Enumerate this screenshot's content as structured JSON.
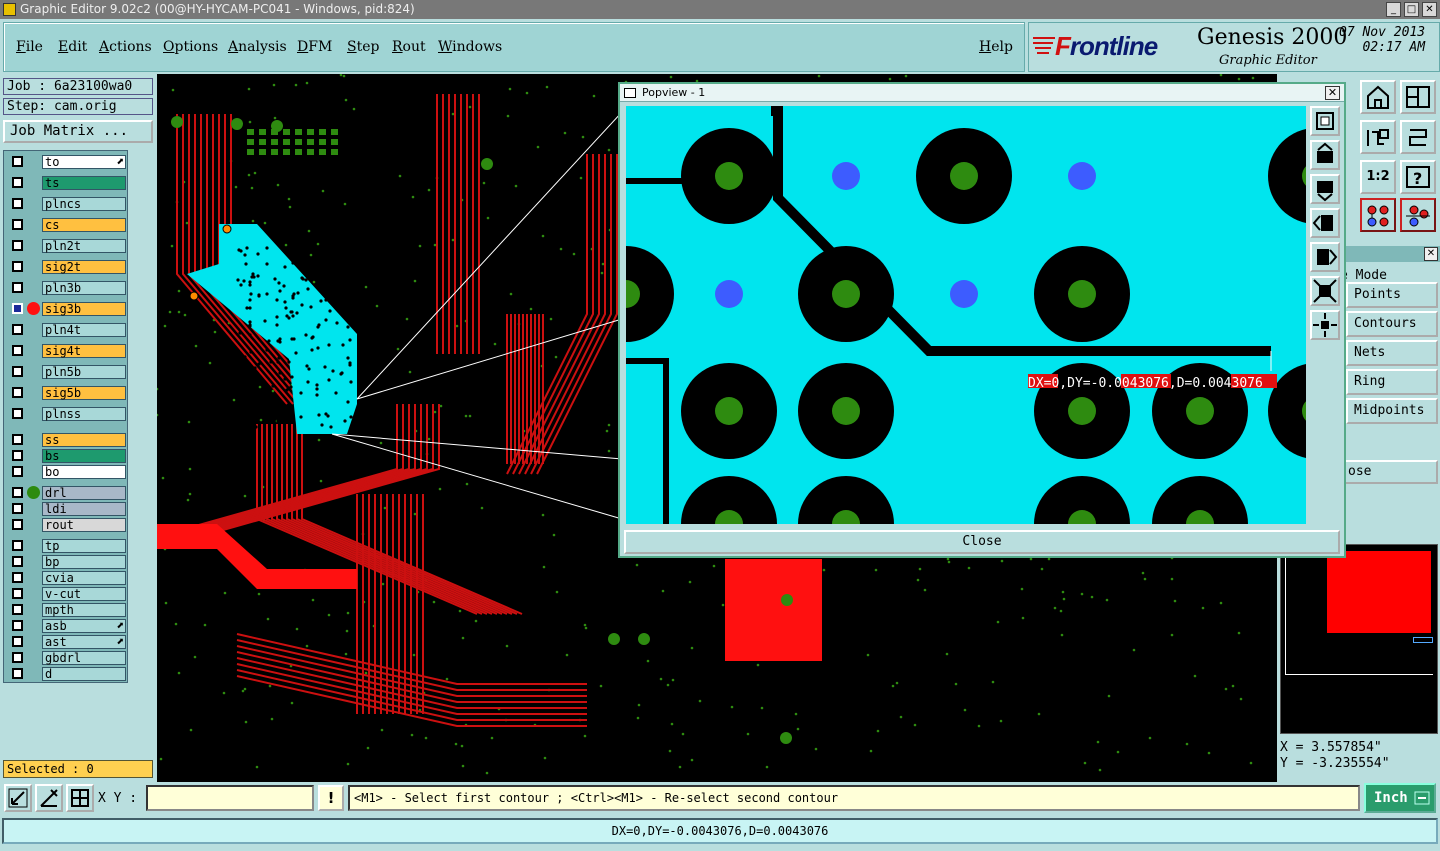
{
  "window": {
    "title": "Graphic Editor 9.02c2 (00@HY-HYCAM-PC041 - Windows, pid:824)"
  },
  "menu": [
    "File",
    "Edit",
    "Actions",
    "Options",
    "Analysis",
    "DFM",
    "Step",
    "Rout",
    "Windows"
  ],
  "help_label": "Help",
  "brand": {
    "logo_prefix": "F",
    "logo_rest": "rontline",
    "product": "Genesis 2000",
    "subtitle": "Graphic Editor",
    "date": "07 Nov 2013",
    "time": "02:17 AM"
  },
  "job": {
    "job": "Job : 6a23100wa0",
    "step": "Step: cam.orig",
    "matrix_button": "Job Matrix ..."
  },
  "layers": [
    {
      "name": "to",
      "color": "#ffffff"
    },
    {
      "name": "ts",
      "color": "#1e9a6e"
    },
    {
      "name": "plncs",
      "color": "#a8d8d8"
    },
    {
      "name": "cs",
      "color": "#ffc040"
    },
    {
      "name": "pln2t",
      "color": "#a8d8d8"
    },
    {
      "name": "sig2t",
      "color": "#ffc040"
    },
    {
      "name": "pln3b",
      "color": "#a8d8d8"
    },
    {
      "name": "sig3b",
      "color": "#ffc040"
    },
    {
      "name": "pln4t",
      "color": "#a8d8d8"
    },
    {
      "name": "sig4t",
      "color": "#ffc040"
    },
    {
      "name": "pln5b",
      "color": "#a8d8d8"
    },
    {
      "name": "sig5b",
      "color": "#ffc040"
    },
    {
      "name": "plnss",
      "color": "#a8d8d8"
    },
    {
      "name": "ss",
      "color": "#ffc040"
    },
    {
      "name": "bs",
      "color": "#1e9a6e"
    },
    {
      "name": "bo",
      "color": "#ffffff"
    },
    {
      "name": "drl",
      "color": "#a8b8c8"
    },
    {
      "name": "ldi",
      "color": "#a8b8c8"
    },
    {
      "name": "rout",
      "color": "#d8d8d8"
    },
    {
      "name": "tp",
      "color": "#a8d8d8"
    },
    {
      "name": "bp",
      "color": "#a8d8d8"
    },
    {
      "name": "cvia",
      "color": "#a8d8d8"
    },
    {
      "name": "v-cut",
      "color": "#a8d8d8"
    },
    {
      "name": "mpth",
      "color": "#a8d8d8"
    },
    {
      "name": "asb",
      "color": "#a8d8d8"
    },
    {
      "name": "ast",
      "color": "#a8d8d8"
    },
    {
      "name": "gbdrl",
      "color": "#a8d8d8"
    },
    {
      "name": "d",
      "color": "#a8d8d8"
    }
  ],
  "selected": "Selected : 0",
  "popview": {
    "title": "Popview - 1",
    "measurement": "DX=0,DY=-0.0043076,D=0.0043076",
    "close_label": "Close"
  },
  "modes": {
    "header": "e Mode",
    "items": [
      "Points",
      "Contours",
      "Nets",
      "Ring",
      "Midpoints"
    ],
    "close_label": "ose"
  },
  "scale_label": "1:2",
  "coords": {
    "x": "X = 3.557854\"",
    "y": "Y = -3.235554\""
  },
  "bottom": {
    "xy_label": "X Y :",
    "xy_value": "",
    "prompt": "<M1> - Select first contour ; <Ctrl><M1> - Re-select second contour",
    "unit": "Inch"
  },
  "status": "DX=0,DY=-0.0043076,D=0.0043076",
  "colors": {
    "background": "#b9dede",
    "copper": "#cc1010",
    "pad": "#2e8b10",
    "fill": "#00e5ee",
    "via": "#3d5cff"
  }
}
